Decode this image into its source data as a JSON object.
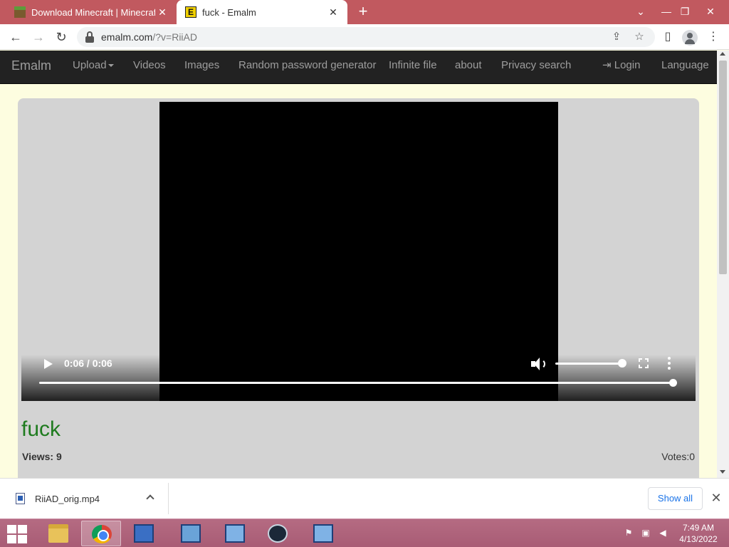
{
  "browser": {
    "tabs": [
      {
        "title": "Download Minecraft | Minecraft",
        "active": false
      },
      {
        "title": "fuck - Emalm",
        "active": true,
        "favicon_letter": "E"
      }
    ],
    "url_host": "emalm.com",
    "url_rest": "/?v=RiiAD"
  },
  "sitenav": {
    "brand": "Emalm",
    "items": [
      "Upload",
      "Videos",
      "Images",
      "Random password generator",
      "Infinite file",
      "about",
      "Privacy search"
    ],
    "login": "Login",
    "language": "Language"
  },
  "video": {
    "time": "0:06 / 0:06",
    "progress": 1.0,
    "volume": 1.0,
    "title": "fuck",
    "views_label": "Views: 9",
    "votes_label": "Votes:0"
  },
  "download": {
    "filename": "RiiAD_orig.mp4",
    "show_all": "Show all"
  },
  "taskbar": {
    "time": "7:49 AM",
    "date": "4/13/2022"
  },
  "colors": {
    "tabbar": "#c1595f",
    "navbar": "#222222",
    "title_green": "#1e7b1e",
    "panel": "#d3d3d3"
  }
}
